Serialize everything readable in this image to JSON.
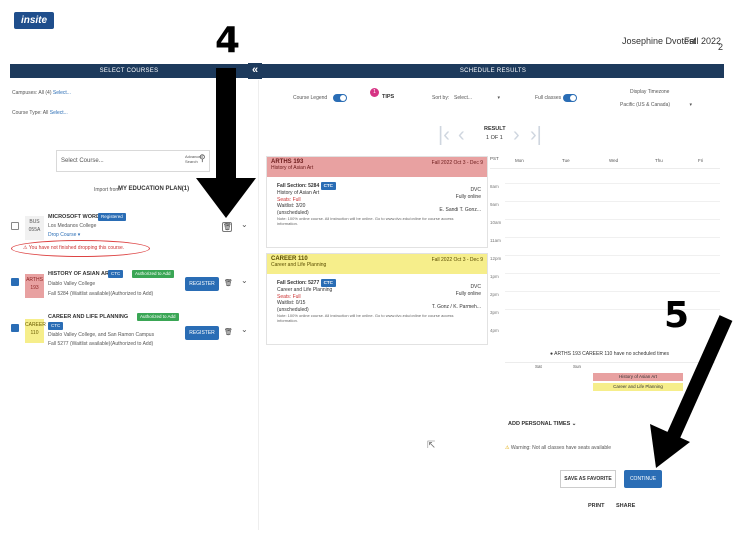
{
  "logo": "insite",
  "user": {
    "name": "Josephine Dvotest",
    "term": "Fall 2022",
    "corner": "2"
  },
  "left": {
    "header": "SELECT COURSES",
    "campuses_label": "Campuses:",
    "campuses_value": "All (4)",
    "campuses_link": "Select...",
    "course_type_label": "Course Type:",
    "course_type_value": "All",
    "course_type_link": "Select...",
    "select_placeholder": "Select Course...",
    "advanced_search": "Advanced Search",
    "import_from": "Import from:",
    "import_plan": "MY EDUCATION PLAN(1)",
    "courses": [
      {
        "code": "BUS 055A",
        "title": "MICROSOFT WORD",
        "badge": "Registered",
        "college": "Los Medanos College",
        "status": "Drop Course",
        "warning": "You have not finished dropping this course."
      },
      {
        "code": "ARTHS 193",
        "title": "HISTORY OF ASIAN ART",
        "badge": "CTC",
        "badge2": "Authorized to Add",
        "college": "Diablo Valley College",
        "status": "Fall 5284 (Waitlist available)(Authorized to Add)",
        "register": "REGISTER"
      },
      {
        "code": "CAREER 110",
        "title": "CAREER AND LIFE PLANNING",
        "badge": "Authorized to Add",
        "badge2": "CTC",
        "college": "Diablo Valley College, and San Ramon Campus",
        "status": "Fall 5277 (Waitlist available)(Authorized to Add)",
        "register": "REGISTER"
      }
    ]
  },
  "right": {
    "header": "SCHEDULE RESULTS",
    "course_legend": "Course Legend",
    "tips": "TIPS",
    "tips_badge": "1",
    "sort_by": "Sort by:",
    "sort_value": "Select...",
    "full_classes": "Full classes",
    "display_timezone": "Display Timezone",
    "timezone_value": "Pacific (US & Canada)",
    "result_label": "RESULT",
    "result_count": "1 OF 1",
    "days": [
      "Mon",
      "Tue",
      "Wed",
      "Thu",
      "Fri"
    ],
    "pst": "PST",
    "times": [
      "8am",
      "9am",
      "10am",
      "11am",
      "12pm",
      "1pm",
      "2pm",
      "3pm",
      "4pm"
    ],
    "unscheduled_note": "ARTHS 193  CAREER 110  have no scheduled times",
    "unscheduled_days": [
      "Sat",
      "Sun"
    ],
    "unscheduled_items": [
      "History of Asian Art",
      "Career and Life Planning"
    ],
    "add_personal": "ADD PERSONAL TIMES",
    "warning": "Warning: Not all classes have seats available",
    "save_fav": "SAVE AS FAVORITE",
    "continue": "CONTINUE",
    "print": "PRINT",
    "share": "SHARE"
  },
  "cards": [
    {
      "code": "ARTHS 193",
      "subtitle": "History of Asian Art",
      "term": "Fall 2022 Oct 3 - Dec 9",
      "section": "Fall Section: 5284",
      "section_tag": "CTC",
      "lines": [
        "History of Asian Art",
        "Seats: Full",
        "Waitlist: 3/20",
        "(unscheduled)"
      ],
      "instr": "E. Sandi T. Gonz...",
      "mode": "Fully online",
      "dvc": "DVC",
      "note": "Note: 100% online course. All instruction will be online. Go to www.dvc.edu/online for course access information."
    },
    {
      "code": "CAREER 110",
      "subtitle": "Career and Life Planning",
      "term": "Fall 2022 Oct 3 - Dec 9",
      "section": "Fall Section: 5277",
      "section_tag": "CTC",
      "lines": [
        "Career and Life Planning",
        "Seats: Full",
        "Waitlist: 0/15",
        "(unscheduled)"
      ],
      "instr": "T. Gonz / K. Parmeh...",
      "mode": "Fully online",
      "dvc": "DVC",
      "note": "Note: 100% online course. All instruction will be online. Go to www.dvc.edu/online for course access information."
    }
  ],
  "annotations": {
    "step4": "4",
    "step5": "5"
  },
  "colors": {
    "accent": "#2a6db5",
    "header": "#1d3a5c",
    "red": "#e8a1a1",
    "yellow": "#f6ee8b",
    "green": "#3aa655"
  }
}
